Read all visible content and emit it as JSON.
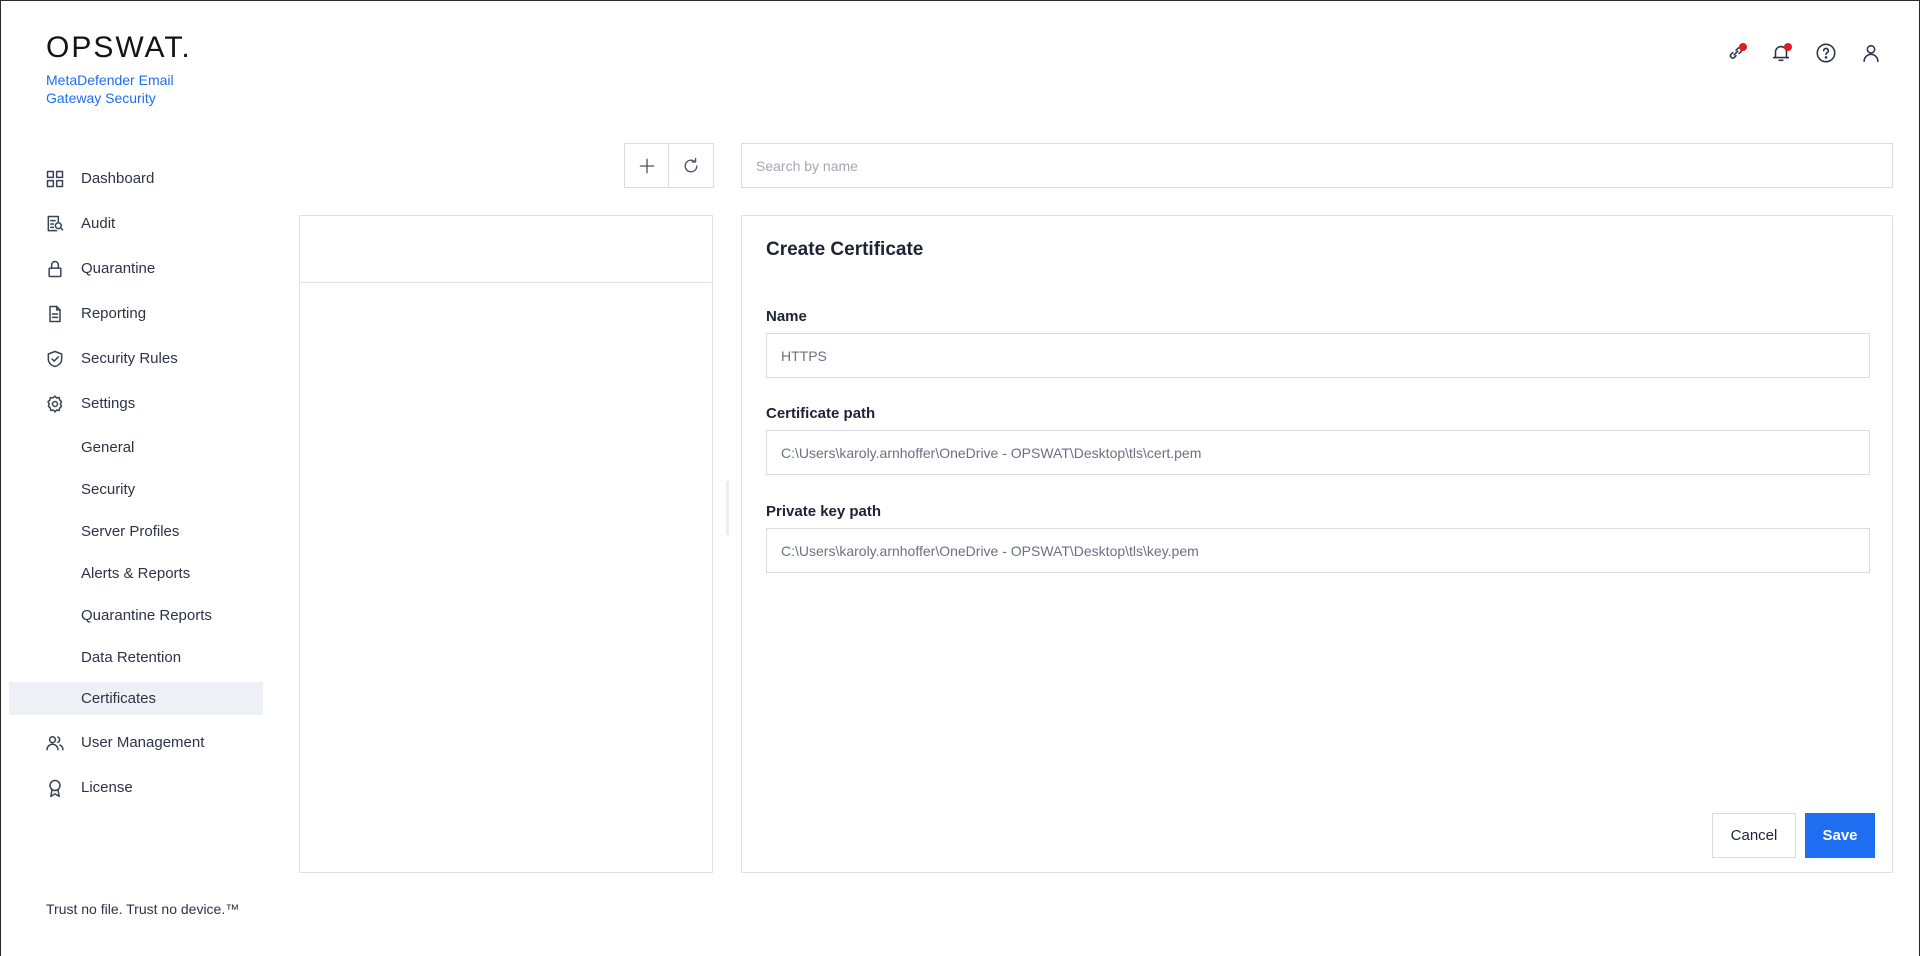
{
  "brand": {
    "logo": "OPSWAT.",
    "product": "MetaDefender Email Gateway Security"
  },
  "topbar": {
    "icons": [
      "link-icon",
      "bell-icon",
      "help-icon",
      "user-icon"
    ],
    "notification_color": "#e11b22"
  },
  "sidebar": {
    "items": [
      {
        "label": "Dashboard",
        "icon": "grid-icon"
      },
      {
        "label": "Audit",
        "icon": "audit-icon"
      },
      {
        "label": "Quarantine",
        "icon": "lock-icon"
      },
      {
        "label": "Reporting",
        "icon": "document-icon"
      },
      {
        "label": "Security Rules",
        "icon": "shield-check-icon"
      },
      {
        "label": "Settings",
        "icon": "gear-icon"
      }
    ],
    "settings_sub": [
      "General",
      "Security",
      "Server Profiles",
      "Alerts & Reports",
      "Quarantine Reports",
      "Data Retention",
      "Certificates"
    ],
    "active_sub": "Certificates",
    "bottom_items": [
      {
        "label": "User Management",
        "icon": "users-icon"
      },
      {
        "label": "License",
        "icon": "award-icon"
      }
    ]
  },
  "tagline": "Trust no file. Trust no device.™",
  "search": {
    "placeholder": "Search by name",
    "value": ""
  },
  "form": {
    "title": "Create Certificate",
    "name_label": "Name",
    "name_value": "HTTPS",
    "cert_label": "Certificate path",
    "cert_value": "C:\\Users\\karoly.arnhoffer\\OneDrive - OPSWAT\\Desktop\\tls\\cert.pem",
    "key_label": "Private key path",
    "key_value": "C:\\Users\\karoly.arnhoffer\\OneDrive - OPSWAT\\Desktop\\tls\\key.pem",
    "cancel_label": "Cancel",
    "save_label": "Save"
  },
  "colors": {
    "accent": "#1d6ef0",
    "active_bg": "#eef0f5"
  }
}
